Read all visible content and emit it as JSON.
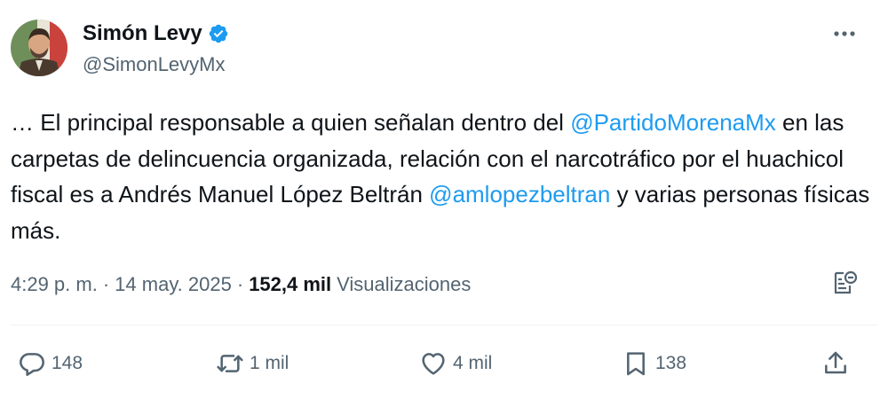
{
  "author": {
    "name": "Simón Levy",
    "handle": "@SimonLevyMx",
    "verified": true
  },
  "tweet": {
    "parts": [
      {
        "type": "text",
        "value": "… El principal responsable a quien señalan dentro del "
      },
      {
        "type": "mention",
        "value": "@PartidoMorenaMx"
      },
      {
        "type": "text",
        "value": " en las carpetas de delincuencia organizada, relación con el narcotráfico por el huachicol fiscal es a Andrés Manuel López Beltrán "
      },
      {
        "type": "mention",
        "value": "@amlopezbeltran"
      },
      {
        "type": "text",
        "value": " y varias personas físicas más."
      }
    ]
  },
  "meta": {
    "time": "4:29 p. m.",
    "separator": "·",
    "date": "14 may. 2025",
    "views_count": "152,4 mil",
    "views_label": "Visualizaciones"
  },
  "actions": {
    "replies": "148",
    "reposts": "1 mil",
    "likes": "4 mil",
    "bookmarks": "138"
  },
  "colors": {
    "accent": "#1d9bf0",
    "text": "#0f1419",
    "secondary": "#536471",
    "divider": "#eff3f4"
  },
  "icons": [
    "verified-badge-icon",
    "more-icon",
    "grok-icon",
    "reply-icon",
    "repost-icon",
    "like-icon",
    "bookmark-icon",
    "share-icon"
  ]
}
